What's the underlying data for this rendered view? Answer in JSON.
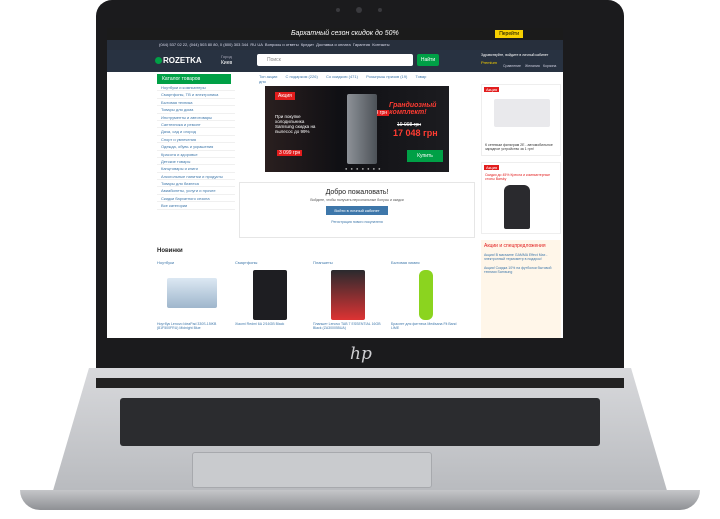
{
  "promo_banner": {
    "text": "Бархатный сезон скидок до 50%",
    "button": "Перейти"
  },
  "topbar": {
    "phone": "(044) 537 02 22, (044) 503 80 80, 0 (800) 303 344",
    "lang_ru": "RU",
    "lang_ua": "UA",
    "links": [
      "Вопросы и ответы",
      "Кредит",
      "Доставка и оплата",
      "Гарантия",
      "Контакты",
      "Отследить заказ",
      "Продавать на Rozetka"
    ]
  },
  "header": {
    "brand": "ROZETKA",
    "city_label": "Город",
    "city": "Киев",
    "search_placeholder": "Поиск",
    "search_button": "Найти",
    "hello": "Здравствуйте,",
    "login": "войдите в личный кабинет",
    "premium": "Premium",
    "compare": "Сравнение",
    "wishlist": "Желания",
    "cart": "Корзина"
  },
  "catalog_button": "Каталог товаров",
  "sidebar": {
    "items": [
      "Ноутбуки и компьютеры",
      "Смартфоны, ТВ и электроника",
      "Бытовая техника",
      "Товары для дома",
      "Инструменты и автотовары",
      "Сантехника и ремонт",
      "Дача, сад и огород",
      "Спорт и увлечения",
      "Одежда, обувь и украшения",
      "Красота и здоровье",
      "Детские товары",
      "Канцтовары и книги",
      "Алкогольные напитки и продукты",
      "Товары для бизнеса",
      "Авиабилеты, услуги и прочее",
      "Скидки бархатного сезона",
      "Все категории"
    ]
  },
  "tabs": [
    "Топ акции",
    "С подарком (226)",
    "Со скидкою (471)",
    "Розыгрыш призов (19)",
    "Товар дня"
  ],
  "main_banner": {
    "flag": "Акция",
    "text": "При покупке холодильника Samsung скидка на пылесос до 99%",
    "price_old_small": "3 099 грн",
    "price_old": "15 899 грн",
    "title": "Грандиозный комплект!",
    "price_before": "19 998 грн",
    "price_now": "17 048 грн",
    "buy": "Купить"
  },
  "welcome": {
    "title": "Добро пожаловать!",
    "subtitle": "Войдите, чтобы получать персональные бонусы и скидки",
    "login_button": "Войти в личный кабинет",
    "register": "Регистрация нового покупателя"
  },
  "right_cards": [
    {
      "tag": "Акция",
      "caption": "К сетевым фильтрам 2E - автомобильное зарядное устройство за 1 грн!"
    },
    {
      "tag": "Акция",
      "caption": "Скидки до 45% Кресла и компьютерные столы Barsky"
    }
  ],
  "deals": {
    "title": "Акции и спецпредложения",
    "items": [
      "Акция! В магазине GAMMA Effect Max - электронный термометр в подарок!",
      "Акция! Скидка 10% на футболки бытовой техники Samsung"
    ]
  },
  "new_section": {
    "title": "Новинки"
  },
  "products": [
    {
      "category": "Ноутбуки",
      "name": "Ноутбук Lenovo IdeaPad 330S-15IKB (81F500FRU) Midnight Blue"
    },
    {
      "category": "Смартфоны",
      "name": "Xiaomi Redmi 6A 2/16GB Black"
    },
    {
      "category": "Планшеты",
      "name": "Планшет Lenovo TAB 7 ESSENTIAL 16GB Black (ZA300055UA)"
    },
    {
      "category": "Бытовая химия",
      "name": "Браслет для фитнеса Medisana Fit Band LIME"
    }
  ],
  "device_logo": "hp"
}
